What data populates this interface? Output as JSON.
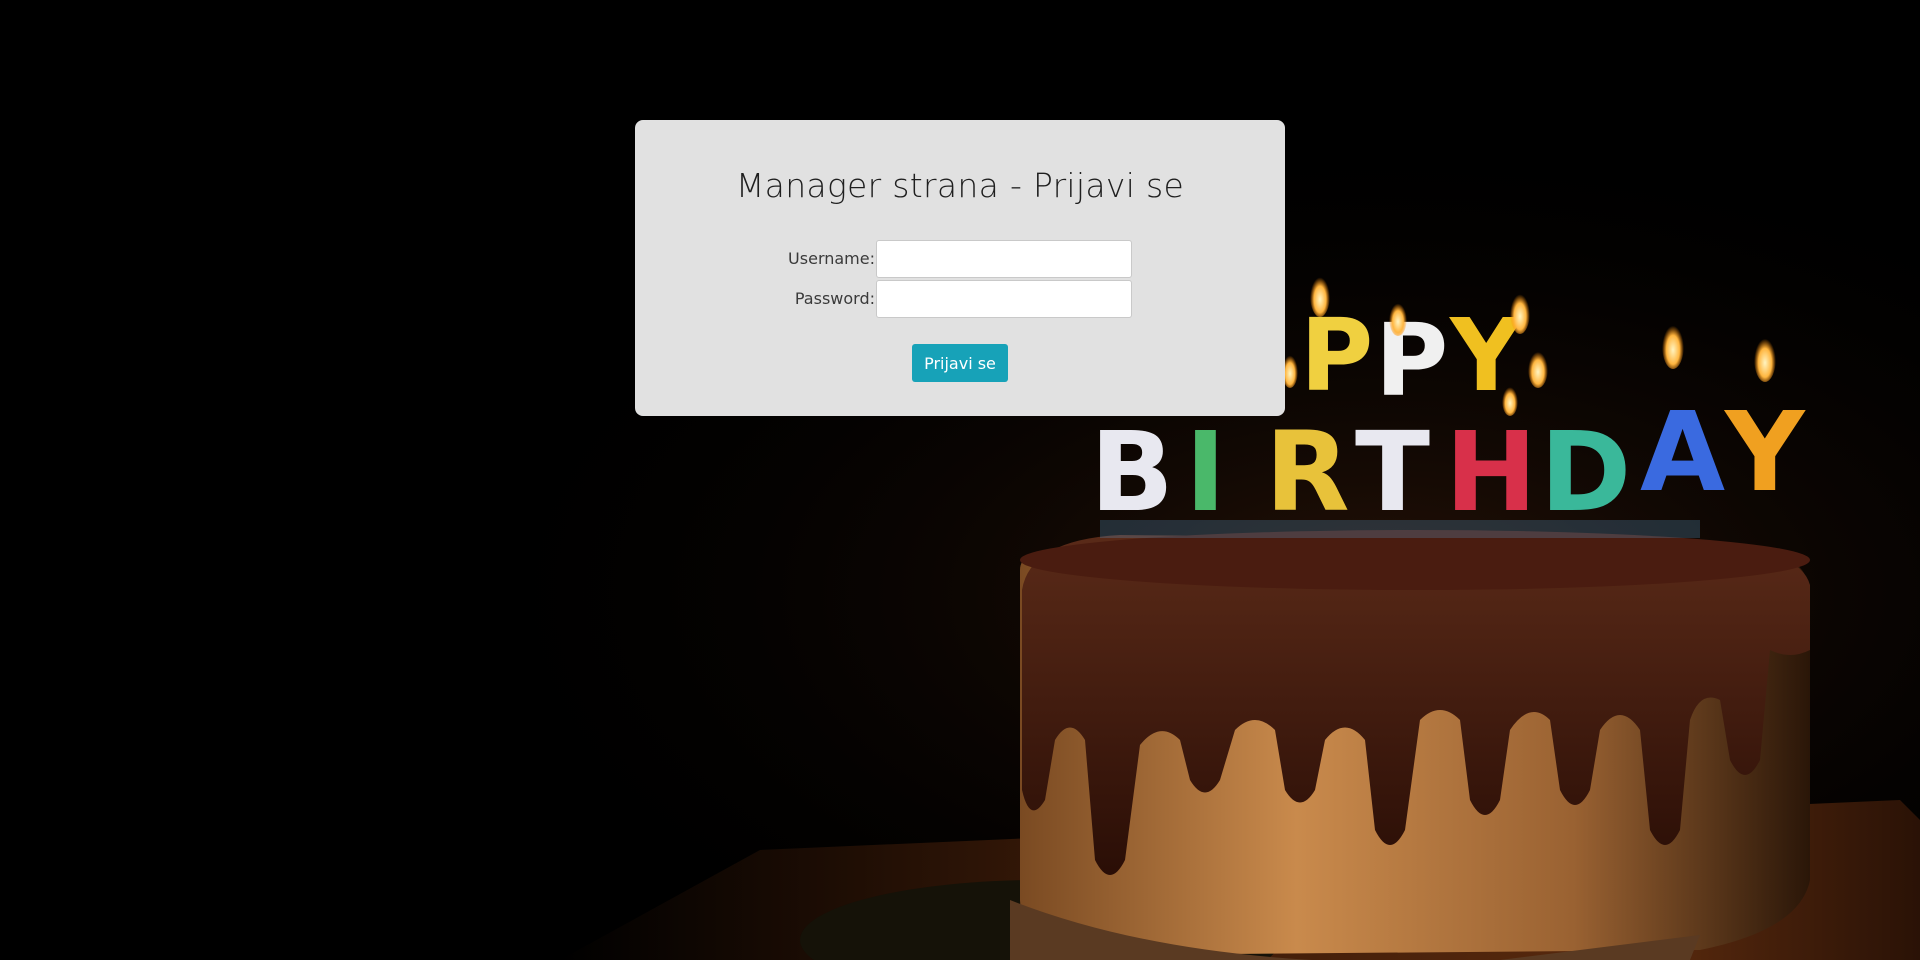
{
  "login": {
    "title": "Manager strana - Prijavi se",
    "username_label": "Username:",
    "username_value": "",
    "password_label": "Password:",
    "password_value": "",
    "submit_label": "Prijavi se"
  },
  "background": {
    "description_icon": "birthday-cake-photo",
    "cake_candle_text": "HAPPY BIRTHDAY"
  },
  "colors": {
    "panel_bg": "#e1e1e1",
    "button_bg": "#17a2b8",
    "page_bg": "#000000"
  }
}
